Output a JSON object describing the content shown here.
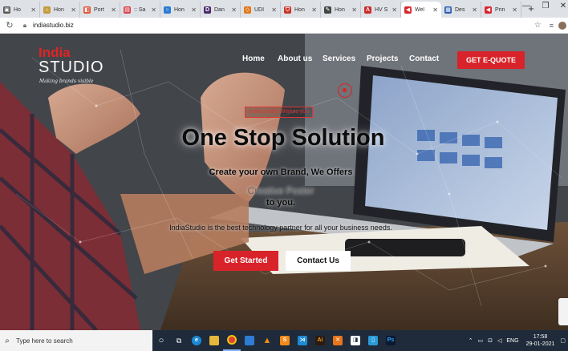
{
  "browser": {
    "tabs": [
      {
        "label": "Ho",
        "fav_color": "#555555",
        "fav_glyph": "▣"
      },
      {
        "label": "Hon",
        "fav_color": "#c49a3a",
        "fav_glyph": "⌂"
      },
      {
        "label": "Port",
        "fav_color": "#e0553a",
        "fav_glyph": "◧"
      },
      {
        "label": ":: Sa",
        "fav_color": "#d9434b",
        "fav_glyph": "▤"
      },
      {
        "label": "Hon",
        "fav_color": "#2a7bd3",
        "fav_glyph": "○"
      },
      {
        "label": "Dan",
        "fav_color": "#4a2a6a",
        "fav_glyph": "D"
      },
      {
        "label": "UDI",
        "fav_color": "#e07a1a",
        "fav_glyph": "◇"
      },
      {
        "label": "Hon",
        "fav_color": "#c8352a",
        "fav_glyph": "⛉"
      },
      {
        "label": "Hon",
        "fav_color": "#444444",
        "fav_glyph": "✎"
      },
      {
        "label": "HV S",
        "fav_color": "#cc2a2a",
        "fav_glyph": "Λ"
      },
      {
        "label": "Wel",
        "fav_color": "#d8232a",
        "fav_glyph": "◀"
      },
      {
        "label": "Des",
        "fav_color": "#2a5db0",
        "fav_glyph": "▦"
      },
      {
        "label": "Prin",
        "fav_color": "#d8232a",
        "fav_glyph": "◀"
      }
    ],
    "active_tab_index": 10,
    "url": "indiastudio.biz"
  },
  "site": {
    "logo": {
      "line1": "India",
      "line2": "STUDIO",
      "tagline": "Making brands visible"
    },
    "nav": [
      "Home",
      "About us",
      "Services",
      "Projects",
      "Contact"
    ],
    "quote_button": "GET E-QUOTE",
    "badge": "India Studio Wishes you",
    "title": "One Stop Solution",
    "line1": "Create your own Brand, We Offers",
    "typed": "Creative Poster",
    "line2": "to you.",
    "description": "IndiaStudio is the best technology partner for all your business needs.",
    "cta_primary": "Get Started",
    "cta_secondary": "Contact Us",
    "accent": "#d8232a"
  },
  "taskbar": {
    "search_placeholder": "Type here to search",
    "lang": "ENG",
    "time": "17:58",
    "date": "29-01-2021"
  }
}
